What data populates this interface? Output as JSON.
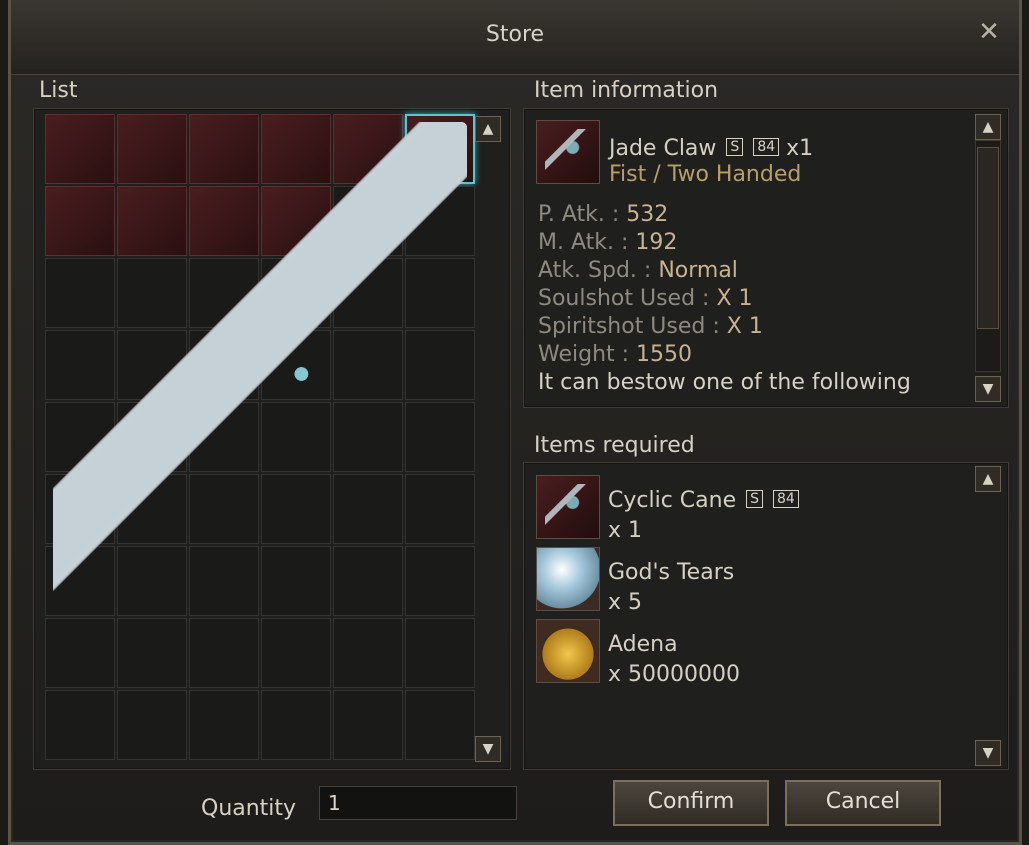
{
  "window": {
    "title": "Store",
    "close_icon": "close-icon"
  },
  "list": {
    "label": "List",
    "items": [
      {
        "name": "item-1"
      },
      {
        "name": "item-2"
      },
      {
        "name": "item-3"
      },
      {
        "name": "item-4"
      },
      {
        "name": "item-5"
      },
      {
        "name": "item-6-selected"
      },
      {
        "name": "item-7"
      },
      {
        "name": "item-8"
      },
      {
        "name": "item-9"
      },
      {
        "name": "item-10"
      }
    ]
  },
  "item_information": {
    "label": "Item information",
    "name": "Jade Claw",
    "grade": "S",
    "level": "84",
    "count": "x1",
    "type": "Fist / Two Handed",
    "stats": [
      {
        "label": "P. Atk. : ",
        "value": "532"
      },
      {
        "label": "M. Atk. : ",
        "value": "192"
      },
      {
        "label": "Atk. Spd. : ",
        "value": "Normal"
      },
      {
        "label": "Soulshot Used : ",
        "value": "X 1"
      },
      {
        "label": "Spiritshot Used : ",
        "value": "X 1"
      },
      {
        "label": "Weight : ",
        "value": "1550"
      }
    ],
    "description": "It can bestow one of the following"
  },
  "items_required": {
    "label": "Items required",
    "items": [
      {
        "name": "Cyclic Cane",
        "grade": "S",
        "level": "84",
        "qty": "x 1"
      },
      {
        "name": "God's Tears",
        "qty": "x 5"
      },
      {
        "name": "Adena",
        "qty": "x 50000000"
      }
    ]
  },
  "quantity": {
    "label": "Quantity",
    "value": "1"
  },
  "buttons": {
    "confirm": "Confirm",
    "cancel": "Cancel"
  }
}
